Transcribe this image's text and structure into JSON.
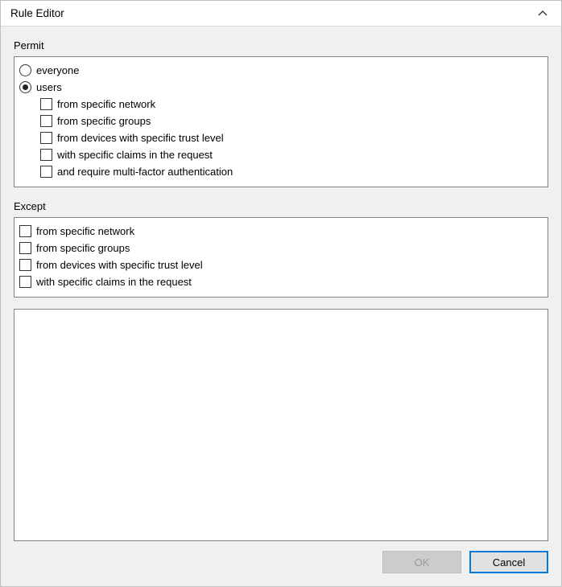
{
  "title": "Rule Editor",
  "permit": {
    "label": "Permit",
    "options": {
      "everyone": "everyone",
      "users": "users"
    },
    "selected": "users",
    "user_conditions": [
      "from specific network",
      "from specific groups",
      "from devices with specific trust level",
      "with specific claims in the request",
      "and require multi-factor authentication"
    ]
  },
  "except": {
    "label": "Except",
    "conditions": [
      "from specific network",
      "from specific groups",
      "from devices with specific trust level",
      "with specific claims in the request"
    ]
  },
  "buttons": {
    "ok": "OK",
    "cancel": "Cancel"
  }
}
